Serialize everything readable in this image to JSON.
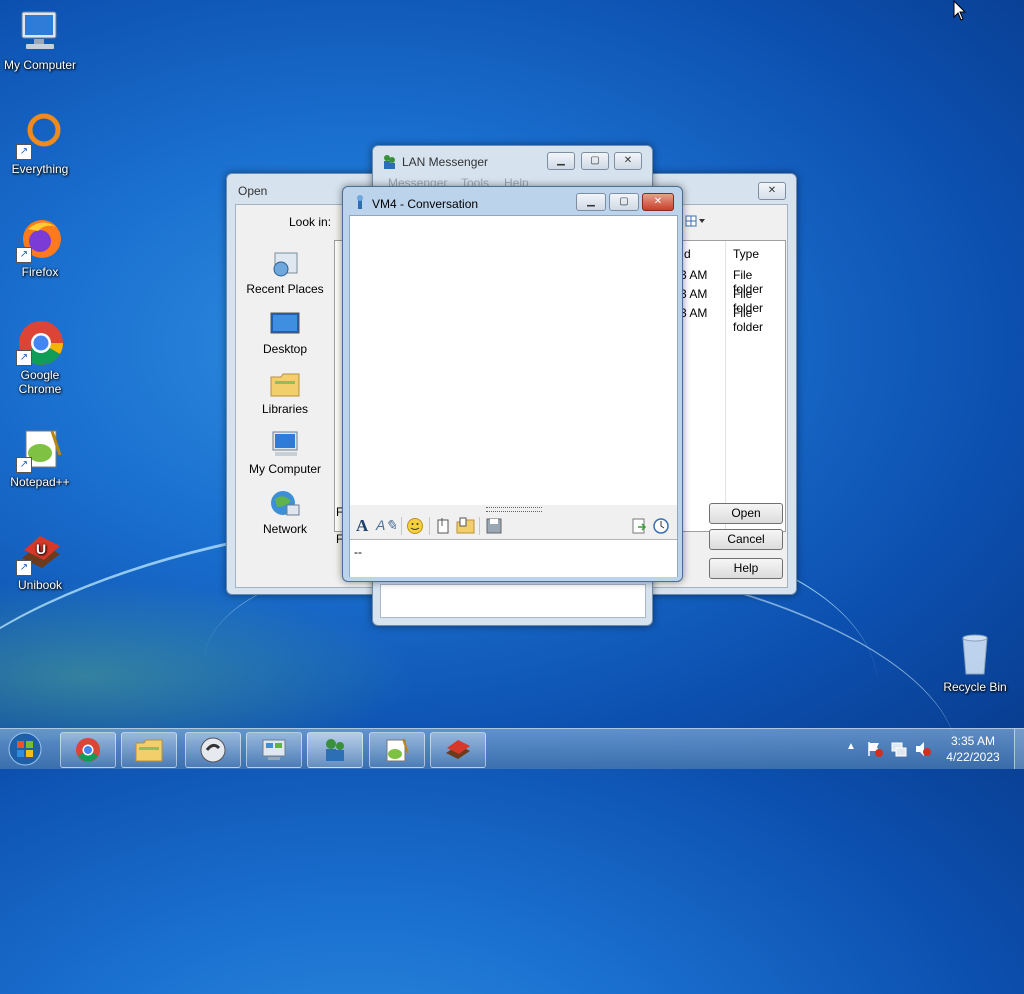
{
  "desktop": {
    "icons": [
      {
        "label": "My Computer",
        "icon": "computer-icon"
      },
      {
        "label": "Everything",
        "icon": "everything-icon"
      },
      {
        "label": "Firefox",
        "icon": "firefox-icon"
      },
      {
        "label": "Google Chrome",
        "icon": "chrome-icon"
      },
      {
        "label": "Notepad++",
        "icon": "notepadpp-icon"
      },
      {
        "label": "Unibook",
        "icon": "unibook-icon"
      },
      {
        "label": "Recycle Bin",
        "icon": "recycle-bin-icon"
      }
    ]
  },
  "open_dialog": {
    "title": "Open",
    "look_in_label": "Look in:",
    "places": [
      "Recent Places",
      "Desktop",
      "Libraries",
      "My Computer",
      "Network"
    ],
    "columns": [
      "d",
      "Type"
    ],
    "rows": [
      {
        "date": "3 AM",
        "type": "File folder"
      },
      {
        "date": "3 AM",
        "type": "File folder"
      },
      {
        "date": "3 AM",
        "type": "File folder"
      }
    ],
    "field_labels": [
      "Fi",
      "Fi"
    ],
    "open_label": "Open",
    "cancel_label": "Cancel",
    "help_label": "Help"
  },
  "lan_messenger": {
    "title": "LAN Messenger",
    "menu": [
      "Messenger",
      "Tools",
      "Help"
    ]
  },
  "conversation": {
    "title": "VM4 - Conversation",
    "input_text": "--",
    "toolbar_icons": [
      "font-icon",
      "font-style-icon",
      "emoticon-icon",
      "send-file-icon",
      "send-folder-icon",
      "save-icon",
      "history-icon",
      "transfers-icon"
    ]
  },
  "taskbar": {
    "items": [
      "start-orb",
      "chrome-icon",
      "explorer-icon",
      "app-icon",
      "control-panel-icon",
      "lan-messenger-icon",
      "notepadpp-icon",
      "unibook-icon"
    ],
    "time": "3:35 AM",
    "date": "4/22/2023"
  }
}
